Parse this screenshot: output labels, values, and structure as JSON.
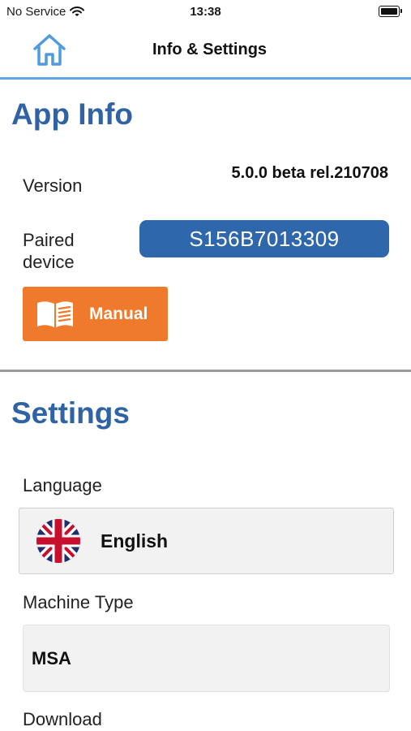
{
  "status_bar": {
    "carrier": "No Service",
    "time": "13:38"
  },
  "nav": {
    "title": "Info & Settings"
  },
  "app_info": {
    "title": "App Info",
    "version_label": "Version",
    "version_value": "5.0.0 beta rel.210708",
    "paired_label_line1": "Paired",
    "paired_label_line2": "device",
    "paired_value": "S156B7013309",
    "manual_label": "Manual"
  },
  "settings": {
    "title": "Settings",
    "language_label": "Language",
    "language_value": "English",
    "machine_type_label": "Machine Type",
    "machine_type_value": "MSA",
    "download_label": "Download"
  },
  "colors": {
    "accent_blue": "#2f63a5",
    "pill_blue": "#2e67ab",
    "manual_orange": "#f07a2b",
    "nav_rule": "#5ea4e3"
  },
  "icons": {
    "home": "home-icon",
    "wifi": "wifi-icon",
    "battery": "battery-icon",
    "book": "book-icon",
    "flag": "uk-flag-icon"
  }
}
